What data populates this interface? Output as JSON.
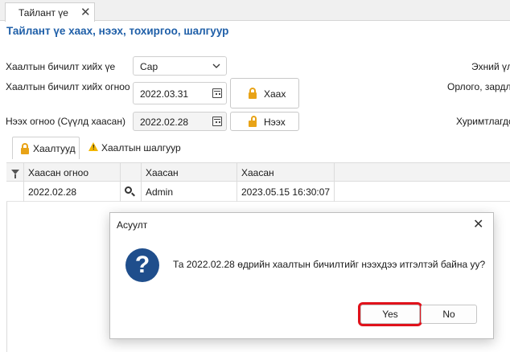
{
  "window": {
    "tab_label": "Тайлант үе",
    "tab_close": "✕"
  },
  "header": {
    "title": "Тайлант үе хаах, нээх, тохиргоо, шалгуур"
  },
  "form": {
    "period_label": "Хаалтын бичилт хийх үе",
    "period_value": "Сар",
    "close_date_label": "Хаалтын бичилт хийх огноо",
    "close_date_value": "2022.03.31",
    "close_button": "Хаах",
    "open_date_label": "Нээх огноо (Сүүлд хаасан)",
    "open_date_value": "2022.02.28",
    "open_button": "Нээх",
    "right_label_1": "Эхний үл",
    "right_label_2": "Орлого, зардл",
    "right_label_3": "Хуримтлагдс"
  },
  "tabs": [
    {
      "label": "Хаалтууд",
      "icon": "lock-icon"
    },
    {
      "label": "Хаалтын шалгуур",
      "icon": "warning-icon"
    }
  ],
  "grid": {
    "columns": [
      "Хаасан огноо",
      "Хаасан",
      "Хаасан"
    ],
    "rows": [
      {
        "date": "2022.02.28",
        "user": "Admin",
        "datetime": "2023.05.15 16:30:07"
      }
    ]
  },
  "dialog": {
    "title": "Асуулт",
    "close": "✕",
    "icon": "question-icon",
    "icon_glyph": "?",
    "message": "Та 2022.02.28 өдрийн хаалтын бичилтийг нээхдээ итгэлтэй байна уу?",
    "yes": "Yes",
    "no": "No"
  },
  "colors": {
    "title_blue": "#1f5fa8",
    "lock_orange": "#e8a317",
    "warning_yellow": "#f2b600",
    "question_blue": "#1f4e8c",
    "highlight_red": "#e0121b"
  }
}
